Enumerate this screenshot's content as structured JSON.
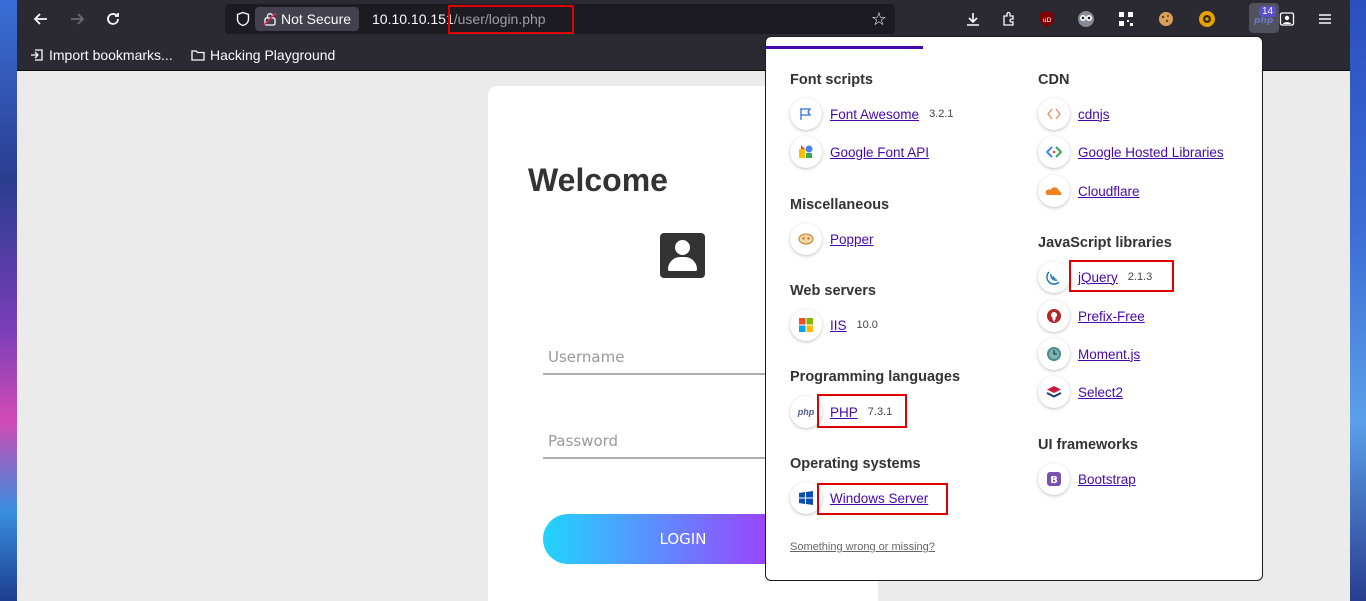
{
  "browser": {
    "security_label": "Not Secure",
    "url_host": "10.10.10.151",
    "url_path": "/user/login.php",
    "extension_badge_count": "14",
    "bookmarks": [
      {
        "label": "Import bookmarks..."
      },
      {
        "label": "Hacking Playground"
      }
    ]
  },
  "login": {
    "title": "Welcome",
    "username_placeholder": "Username",
    "password_placeholder": "Password",
    "button_label": "LOGIN"
  },
  "wappalyzer": {
    "left_column": [
      {
        "category": "Font scripts",
        "items": [
          {
            "name": "Font Awesome",
            "version": "3.2.1",
            "icon": "flag-icon"
          },
          {
            "name": "Google Font API",
            "version": "",
            "icon": "google-font-icon"
          }
        ]
      },
      {
        "category": "Miscellaneous",
        "items": [
          {
            "name": "Popper",
            "version": "",
            "icon": "popper-icon"
          }
        ]
      },
      {
        "category": "Web servers",
        "items": [
          {
            "name": "IIS",
            "version": "10.0",
            "icon": "windows-grid-icon"
          }
        ]
      },
      {
        "category": "Programming languages",
        "items": [
          {
            "name": "PHP",
            "version": "7.3.1",
            "icon": "php-icon"
          }
        ]
      },
      {
        "category": "Operating systems",
        "items": [
          {
            "name": "Windows Server",
            "version": "",
            "icon": "windows-logo-icon"
          }
        ]
      }
    ],
    "right_column": [
      {
        "category": "CDN",
        "items": [
          {
            "name": "cdnjs",
            "version": "",
            "icon": "cdnjs-icon"
          },
          {
            "name": "Google Hosted Libraries",
            "version": "",
            "icon": "google-hosted-icon"
          },
          {
            "name": "Cloudflare",
            "version": "",
            "icon": "cloud-icon"
          }
        ]
      },
      {
        "category": "JavaScript libraries",
        "items": [
          {
            "name": "jQuery",
            "version": "2.1.3",
            "icon": "jquery-icon"
          },
          {
            "name": "Prefix-Free",
            "version": "",
            "icon": "prefix-free-icon"
          },
          {
            "name": "Moment.js",
            "version": "",
            "icon": "clock-icon"
          },
          {
            "name": "Select2",
            "version": "",
            "icon": "layers-icon"
          }
        ]
      },
      {
        "category": "UI frameworks",
        "items": [
          {
            "name": "Bootstrap",
            "version": "",
            "icon": "bootstrap-icon"
          }
        ]
      }
    ],
    "footer_link": "Something wrong or missing?"
  },
  "colors": {
    "highlight": "#e00000",
    "link": "#4608ad",
    "login_gradient_start": "#21d4fd",
    "login_gradient_end": "#b721ff"
  }
}
